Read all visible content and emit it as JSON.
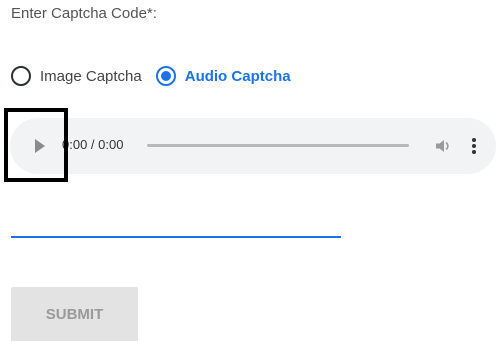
{
  "form": {
    "title": "Enter Captcha Code*:",
    "options": [
      {
        "label": "Image Captcha",
        "selected": false
      },
      {
        "label": "Audio Captcha",
        "selected": true
      }
    ],
    "accent_color": "#1a73e8"
  },
  "audio_player": {
    "time_display": "0:00 / 0:00",
    "icons": [
      "play-icon",
      "volume-icon",
      "more-vert-icon"
    ]
  },
  "captcha_input": {
    "value": "",
    "placeholder": ""
  },
  "submit": {
    "label": "SUBMIT"
  }
}
